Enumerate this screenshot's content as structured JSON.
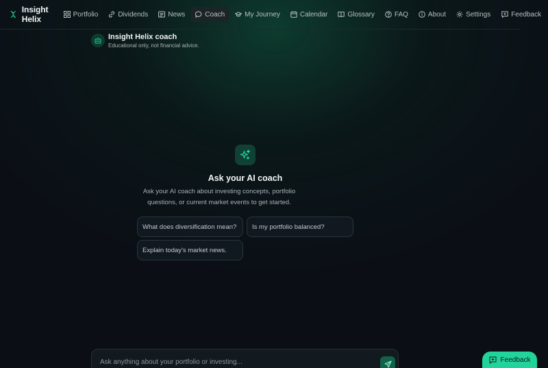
{
  "brand": {
    "name": "Insight Helix",
    "icon": "helix-logo-icon"
  },
  "nav": [
    {
      "label": "Portfolio",
      "icon": "grid-icon",
      "active": false
    },
    {
      "label": "Dividends",
      "icon": "link-icon",
      "active": false
    },
    {
      "label": "News",
      "icon": "newspaper-icon",
      "active": false
    },
    {
      "label": "Coach",
      "icon": "chat-bubble-icon",
      "active": true
    },
    {
      "label": "My Journey",
      "icon": "graduation-cap-icon",
      "active": false
    },
    {
      "label": "Calendar",
      "icon": "calendar-icon",
      "active": false
    },
    {
      "label": "Glossary",
      "icon": "book-icon",
      "active": false
    },
    {
      "label": "FAQ",
      "icon": "help-circle-icon",
      "active": false
    },
    {
      "label": "About",
      "icon": "info-circle-icon",
      "active": false
    },
    {
      "label": "Settings",
      "icon": "gear-icon",
      "active": false
    },
    {
      "label": "Feedback",
      "icon": "message-plus-icon",
      "active": false
    }
  ],
  "coach": {
    "title": "Insight Helix coach",
    "subtitle": "Educational only, not financial advice."
  },
  "empty_state": {
    "title": "Ask your AI coach",
    "description": "Ask your AI coach about investing concepts, portfolio questions, or current market events to get started.",
    "suggestions": [
      "What does diversification mean?",
      "Is my portfolio balanced?",
      "Explain today's market news."
    ]
  },
  "composer": {
    "placeholder": "Ask anything about your portfolio or investing...",
    "value": ""
  },
  "floating_feedback": {
    "label": "Feedback"
  },
  "colors": {
    "accent": "#22d39a",
    "background": "#0b0f15",
    "accent_dark": "#10624a"
  }
}
